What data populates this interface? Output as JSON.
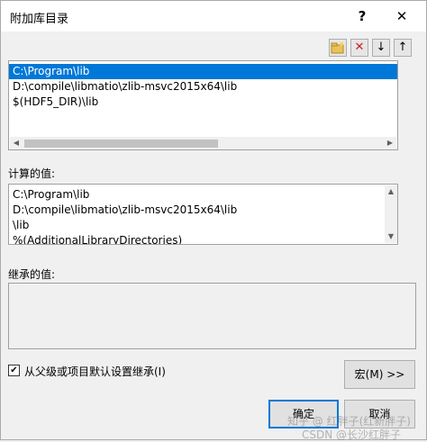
{
  "window": {
    "title": "附加库目录",
    "help_icon": "?",
    "close_icon": "✕"
  },
  "toolbar": {
    "new_folder_icon": "new-folder-icon",
    "delete_icon": "✕",
    "move_down_icon": "↓",
    "move_up_icon": "↑"
  },
  "directories": {
    "items": [
      "C:\\Program\\lib",
      "D:\\compile\\libmatio\\zlib-msvc2015x64\\lib",
      "$(HDF5_DIR)\\lib"
    ],
    "selected_index": 0
  },
  "evaluated": {
    "label": "计算的值:",
    "lines": [
      "C:\\Program\\lib",
      "D:\\compile\\libmatio\\zlib-msvc2015x64\\lib",
      "\\lib",
      "%(AdditionalLibraryDirectories)"
    ]
  },
  "inherited": {
    "label": "继承的值:"
  },
  "inherit_checkbox": {
    "checked": true,
    "label": "从父级或项目默认设置继承(I)"
  },
  "buttons": {
    "macros": "宏(M) >>",
    "ok": "确定",
    "cancel": "取消"
  },
  "watermark": {
    "line1": "知乎 @ 红胖子(红新胖子)",
    "line2": "CSDN @长沙红胖子"
  }
}
